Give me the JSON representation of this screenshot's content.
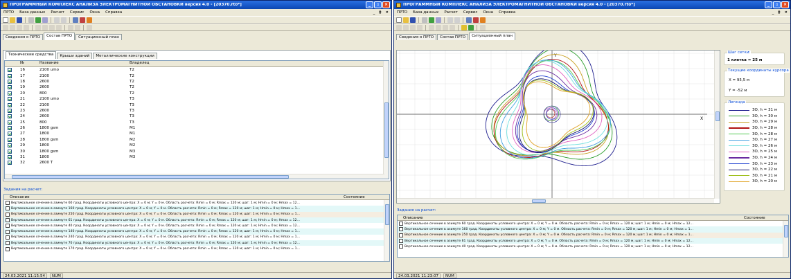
{
  "app": {
    "title": "ПРОГРАММНЫЙ КОМПЛЕКС АНАЛИЗА ЭЛЕКТРОМАГНИТНОЙ ОБСТАНОВКИ версия 4.0 - [20370.rto*]",
    "menu": [
      "ПРТО",
      "База данных",
      "Расчет",
      "Сервис",
      "Окна",
      "Справка"
    ],
    "mdi_controls": [
      "_",
      "ǂ",
      "×"
    ],
    "window_buttons": [
      "_",
      "▫",
      "×"
    ]
  },
  "win1": {
    "tabs": [
      "Сведения о ПРТО",
      "Состав ПРТО",
      "Ситуационный план"
    ],
    "active_tab": 1,
    "subtabs": [
      "Технические средства",
      "Крыши зданий",
      "Металлические конструкции"
    ],
    "table": {
      "columns": [
        "№",
        "Название",
        "Владелец"
      ],
      "rows": [
        {
          "n": "16",
          "name": "2100 umo",
          "owner": "T2"
        },
        {
          "n": "17",
          "name": "2100",
          "owner": "T2"
        },
        {
          "n": "18",
          "name": "2600",
          "owner": "T2"
        },
        {
          "n": "19",
          "name": "2600",
          "owner": "T2"
        },
        {
          "n": "20",
          "name": "800",
          "owner": "T2"
        },
        {
          "n": "21",
          "name": "2100 umo",
          "owner": "T3"
        },
        {
          "n": "22",
          "name": "2100",
          "owner": "T3"
        },
        {
          "n": "23",
          "name": "2600",
          "owner": "T3"
        },
        {
          "n": "24",
          "name": "2600",
          "owner": "T3"
        },
        {
          "n": "25",
          "name": "800",
          "owner": "T3"
        },
        {
          "n": "26",
          "name": "1800 gsm",
          "owner": "M1"
        },
        {
          "n": "27",
          "name": "1800",
          "owner": "M1"
        },
        {
          "n": "28",
          "name": "1800 gsm",
          "owner": "M2"
        },
        {
          "n": "29",
          "name": "1800",
          "owner": "M2"
        },
        {
          "n": "30",
          "name": "1800 gsm",
          "owner": "M3"
        },
        {
          "n": "31",
          "name": "1800",
          "owner": "M3"
        },
        {
          "n": "32",
          "name": "2600 T",
          "owner": ""
        }
      ]
    },
    "tasks_title": "Задания на расчет:",
    "tasks_columns": [
      "Описание",
      "Состояние"
    ],
    "tasks": [
      "Вертикальное сечение в азимуте 60 град. Координаты условного центра: X = 0 м; Y = 0 м. Область расчета: Rmin = 0 м; Rmax = 120 м; шаг: 1 м; Hmin = 0 м; Hmax = 12...",
      "Вертикальное сечение в азимуте 160 град. Координаты условного центра: X = 0 м; Y = 0 м. Область расчета: Rmin = 0 м; Rmax = 120 м; шаг: 1 м; Hmin = 0 м; Hmax = 1...",
      "Вертикальное сечение в азимуте 250 град. Координаты условного центра: X = 0 м; Y = 0 м. Область расчета: Rmin = 0 м; Rmax = 120 м; шаг: 1 м; Hmin = 0 м; Hmax = 1...",
      "Вертикальное сечение в азимуте 61 град. Координаты условного центра: X = 0 м; Y = 0 м. Область расчета: Rmin = 0 м; Rmax = 120 м; шаг: 1 м; Hmin = 0 м; Hmax = 12...",
      "Вертикальное сечение в азимуте 40 град. Координаты условного центра: X = 0 м; Y = 0 м. Область расчета: Rmin = 0 м; Rmax = 120 м; шаг: 1 м; Hmin = 0 м; Hmax = 12...",
      "Вертикальное сечение в азимуте 140 град. Координаты условного центра: X = 0 м; Y = 0 м. Область расчета: Rmin = 0 м; Rmax = 120 м; шаг: 1 м; Hmin = 0 м; Hmax = 1...",
      "Вертикальное сечение в азимуте 240 град. Координаты условного центра: X = 0 м; Y = 0 м. Область расчета: Rmin = 0 м; Rmax = 120 м; шаг: 1 м; Hmin = 0 м; Hmax = 1...",
      "Вертикальное сечение в азимуте 70 град. Координаты условного центра: X = 0 м; Y = 0 м. Область расчета: Rmin = 0 м; Rmax = 120 м; шаг: 1 м; Hmin = 0 м; Hmax = 12...",
      "Вертикальное сечение в азимуте 170 град. Координаты условного центра: X = 0 м; Y = 0 м. Область расчета: Rmin = 0 м; Rmax = 120 м; шаг: 1 м; Hmin = 0 м; Hmax = 1..."
    ],
    "status_time": "24.03.2021 11:15:54",
    "status_mode": "NUM"
  },
  "win2": {
    "tabs": [
      "Сведения о ПРТО",
      "Состав ПРТО",
      "Ситуационный план"
    ],
    "active_tab": 2,
    "axis_x": "X",
    "axis_y": "Y",
    "grid_title": "Шаг сетки:",
    "grid_value": "1 клетка = 25 м",
    "coords_title": "Текущие координаты курсора",
    "coord_x": "X = 95,5 м",
    "coord_y": "Y = -52 м",
    "legend_title": "Легенда",
    "legend": [
      {
        "label": "ЗО, h = 31 м",
        "color": "#1a1a8c"
      },
      {
        "label": "ЗО, h = 30 м",
        "color": "#2a9e2a"
      },
      {
        "label": "ЗО, h = 29 м",
        "color": "#c8a020"
      },
      {
        "label": "ЗО, h = 28 м",
        "color": "#b01010"
      },
      {
        "label": "ЗО, h = 28 м",
        "color": "#50c850"
      },
      {
        "label": "ЗО, h = 27 м",
        "color": "#40a0e0"
      },
      {
        "label": "ЗО, h = 26 м",
        "color": "#70e0e0"
      },
      {
        "label": "ЗО, h = 25 м",
        "color": "#e060c0"
      },
      {
        "label": "ЗО, h = 24 м",
        "color": "#6a2aa0"
      },
      {
        "label": "ЗО, h = 23 м",
        "color": "#2040d0"
      },
      {
        "label": "ЗО, h = 22 м",
        "color": "#10106a"
      },
      {
        "label": "ЗО, h = 21 м",
        "color": "#a0c020"
      },
      {
        "label": "ЗО, h = 20 м",
        "color": "#e0a020"
      }
    ],
    "tasks_title": "Задания на расчет:",
    "tasks_columns": [
      "Описание",
      "Состояние"
    ],
    "tasks": [
      "Вертикальное сечение в азимуте 60 град. Координаты условного центра: X = 0 м; Y = 0 м. Область расчета: Rmin = 0 м; Rmax = 120 м; шаг: 1 м; Hmin = 0 м; Hmax = 12...",
      "Вертикальное сечение в азимуте 160 град. Координаты условного центра: X = 0 м; Y = 0 м. Область расчета: Rmin = 0 м; Rmax = 120 м; шаг: 1 м; Hmin = 0 м; Hmax = 1...",
      "Вертикальное сечение в азимуте 250 град. Координаты условного центра: X = 0 м; Y = 0 м. Область расчета: Rmin = 0 м; Rmax = 120 м; шаг: 1 м; Hmin = 0 м; Hmax = 1...",
      "Вертикальное сечение в азимуте 61 град. Координаты условного центра: X = 0 м; Y = 0 м. Область расчета: Rmin = 0 м; Rmax = 120 м; шаг: 1 м; Hmin = 0 м; Hmax = 12...",
      "Вертикальное сечение в азимуте 40 град. Координаты условного центра: X = 0 м; Y = 0 м. Область расчета: Rmin = 0 м; Rmax = 120 м; шаг: 1 м; Hmin = 0 м; Hmax = 12..."
    ],
    "status_time": "24.03.2021 11:23:07",
    "status_mode": "NUM"
  }
}
